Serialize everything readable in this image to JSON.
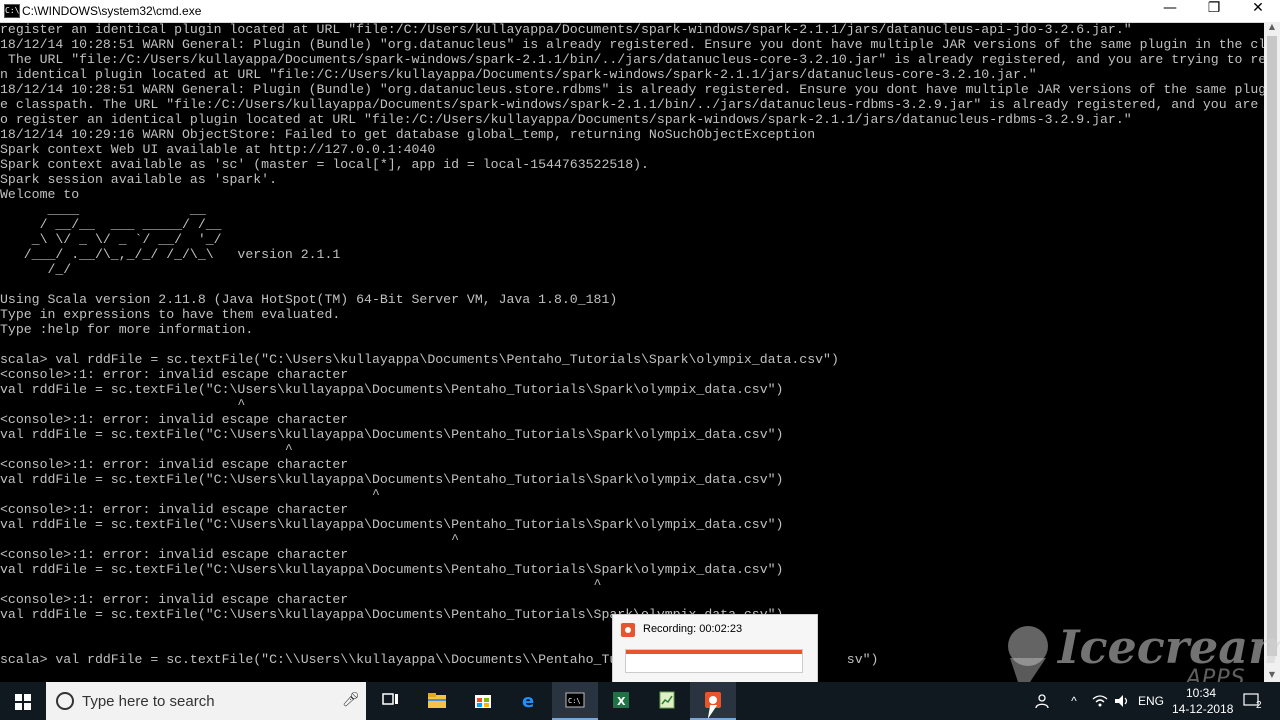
{
  "window": {
    "title": "C:\\WINDOWS\\system32\\cmd.exe",
    "app_icon_text": "C:\\",
    "minimize_glyph": "—",
    "maximize_glyph": "❐",
    "close_glyph": "✕"
  },
  "console": {
    "lines": [
      "register an identical plugin located at URL \"file:/C:/Users/kullayappa/Documents/spark-windows/spark-2.1.1/jars/datanucleus-api-jdo-3.2.6.jar.\"",
      "18/12/14 10:28:51 WARN General: Plugin (Bundle) \"org.datanucleus\" is already registered. Ensure you dont have multiple JAR versions of the same plugin in the classpath.",
      " The URL \"file:/C:/Users/kullayappa/Documents/spark-windows/spark-2.1.1/bin/../jars/datanucleus-core-3.2.10.jar\" is already registered, and you are trying to register a",
      "n identical plugin located at URL \"file:/C:/Users/kullayappa/Documents/spark-windows/spark-2.1.1/jars/datanucleus-core-3.2.10.jar.\"",
      "18/12/14 10:28:51 WARN General: Plugin (Bundle) \"org.datanucleus.store.rdbms\" is already registered. Ensure you dont have multiple JAR versions of the same plugin in th",
      "e classpath. The URL \"file:/C:/Users/kullayappa/Documents/spark-windows/spark-2.1.1/bin/../jars/datanucleus-rdbms-3.2.9.jar\" is already registered, and you are trying t",
      "o register an identical plugin located at URL \"file:/C:/Users/kullayappa/Documents/spark-windows/spark-2.1.1/jars/datanucleus-rdbms-3.2.9.jar.\"",
      "18/12/14 10:29:16 WARN ObjectStore: Failed to get database global_temp, returning NoSuchObjectException",
      "Spark context Web UI available at http://127.0.0.1:4040",
      "Spark context available as 'sc' (master = local[*], app id = local-1544763522518).",
      "Spark session available as 'spark'.",
      "Welcome to",
      "      ____              __",
      "     / __/__  ___ _____/ /__",
      "    _\\ \\/ _ \\/ _ `/ __/  '_/",
      "   /___/ .__/\\_,_/_/ /_/\\_\\   version 2.1.1",
      "      /_/",
      "",
      "Using Scala version 2.11.8 (Java HotSpot(TM) 64-Bit Server VM, Java 1.8.0_181)",
      "Type in expressions to have them evaluated.",
      "Type :help for more information.",
      "",
      "scala> val rddFile = sc.textFile(\"C:\\Users\\kullayappa\\Documents\\Pentaho_Tutorials\\Spark\\olympix_data.csv\")",
      "<console>:1: error: invalid escape character",
      "val rddFile = sc.textFile(\"C:\\Users\\kullayappa\\Documents\\Pentaho_Tutorials\\Spark\\olympix_data.csv\")",
      "                              ^",
      "<console>:1: error: invalid escape character",
      "val rddFile = sc.textFile(\"C:\\Users\\kullayappa\\Documents\\Pentaho_Tutorials\\Spark\\olympix_data.csv\")",
      "                                    ^",
      "<console>:1: error: invalid escape character",
      "val rddFile = sc.textFile(\"C:\\Users\\kullayappa\\Documents\\Pentaho_Tutorials\\Spark\\olympix_data.csv\")",
      "                                               ^",
      "<console>:1: error: invalid escape character",
      "val rddFile = sc.textFile(\"C:\\Users\\kullayappa\\Documents\\Pentaho_Tutorials\\Spark\\olympix_data.csv\")",
      "                                                         ^",
      "<console>:1: error: invalid escape character",
      "val rddFile = sc.textFile(\"C:\\Users\\kullayappa\\Documents\\Pentaho_Tutorials\\Spark\\olympix_data.csv\")",
      "                                                                           ^",
      "<console>:1: error: invalid escape character",
      "val rddFile = sc.textFile(\"C:\\Users\\kullayappa\\Documents\\Pentaho_Tutorials\\Spark\\olympix_data.csv\")",
      "",
      "",
      "scala> val rddFile = sc.textFile(\"C:\\\\Users\\\\kullayappa\\\\Documents\\\\Pentaho_Tutori                         sv\")"
    ]
  },
  "recording": {
    "label": "Recording:  00:02:23"
  },
  "watermark": {
    "brand": "Icecream",
    "apps": "APPS"
  },
  "taskbar": {
    "search_placeholder": "Type here to search",
    "apps": [
      "task-view-icon",
      "file-explorer-icon",
      "store-icon",
      "edge-icon",
      "cmd-icon",
      "excel-icon",
      "notepad-icon",
      "icecream-recorder-icon"
    ],
    "active_app": "cmd-icon"
  },
  "tray": {
    "language": "ENG",
    "time": "10:34",
    "date": "14-12-2018",
    "notification_count": "2"
  },
  "colors": {
    "console_bg": "#000000",
    "console_text": "#c0c0c0",
    "taskbar_bg": "#101820",
    "recording_accent": "#e8542c"
  }
}
